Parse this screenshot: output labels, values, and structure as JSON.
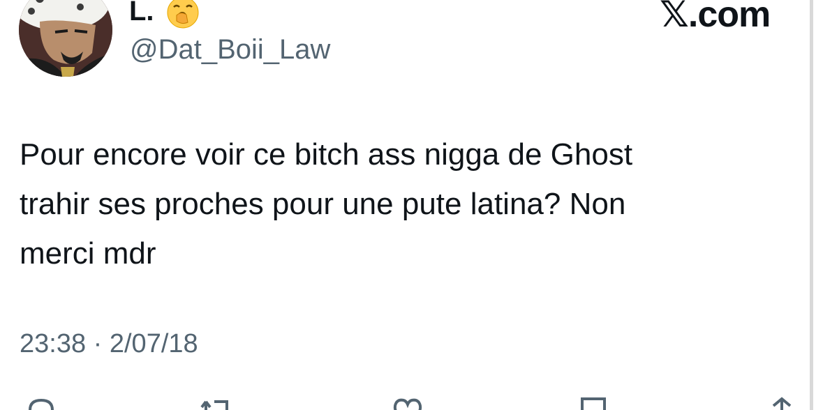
{
  "header": {
    "display_name": "L.",
    "display_name_emoji": "yawning-face-emoji",
    "handle": "@Dat_Boii_Law",
    "brand": "𝕏.com"
  },
  "tweet": {
    "text": "Pour encore voir ce bitch ass nigga de Ghost\ntrahir ses proches pour une pute latina? Non\nmerci mdr",
    "timestamp": "23:38 · 2/07/18"
  },
  "actions": [
    {
      "icon": "reply-icon"
    },
    {
      "icon": "retweet-icon"
    },
    {
      "icon": "like-icon"
    },
    {
      "icon": "bookmark-icon"
    },
    {
      "icon": "share-icon"
    }
  ],
  "colors": {
    "text_primary": "#0f1419",
    "text_secondary": "#536471",
    "background": "#ffffff"
  }
}
